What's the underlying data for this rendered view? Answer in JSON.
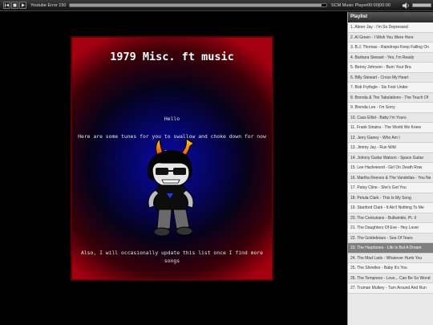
{
  "player": {
    "track_title": "Youtube Error 150",
    "player_name": "SCM Music Player",
    "time": "00:00|00:00",
    "progress": 0.98,
    "volume": 1.0
  },
  "card": {
    "title": "1979 Misc. ft music",
    "hello": "Hello",
    "tunes": "Here are some tunes for you to swallow and choke down for now",
    "enjoy": "Enjoy",
    "footer": "Also, I will occasionally update this list once I find more songs"
  },
  "playlist": {
    "header": "Playlist",
    "active_index": 22,
    "items": [
      "1. Abner Jay - I'm So Depressed",
      "2. Al Green - I Wish You Were Here",
      "3. B.J. Thomas - Raindrops Keep Falling On",
      "4. Barbara Stewart - Yes, I'm Ready",
      "5. Benny Johnson - Burn Your Bra",
      "6. Billy Stewart - Cross My Heart",
      "7. Bob Fryfogle - Six Foot Under",
      "8. Brenda & The Tabulations - The Touch Of",
      "9. Brenda Lee - I'm Sorry",
      "10. Cass Elliot - Baby I'm Yours",
      "11. Frank Sinatra - The World We Knew",
      "12. Jerry Ganey - Who Am I",
      "13. Jimmy Jay - Run Wild",
      "14. Johnny Guitar Watson - Space Guitar",
      "15. Lee Hazlewood - Girl On Death Row",
      "16. Martha Reeves & The Vandellas - You Ne",
      "17. Patsy Cline - She's Got You",
      "18. Petula Clark - This Is My Song",
      "19. Stanford Clark - It Ain't Nothing To Me",
      "20. The Centurians - Bullwinkle, Pt. II",
      "21. The Daughters Of Eve - Hey Lover",
      "22. The Goldebriars - Sea Of Tears",
      "23. The Harptones - Life Is But A Dream",
      "24. The Mad Lads - Whatever Hurts You",
      "25. The Shirelles - Baby It's You",
      "26. The Temprees - Love... Can Be So Wond",
      "27. Truman Mulkey - Turn Around And Run"
    ]
  },
  "colors": {
    "card_glow_center": "#0a0aaa",
    "card_edge": "#a50010",
    "active_row": "#7f7f7f",
    "horn_gradient_start": "#ff4a00",
    "horn_gradient_end": "#ffd000"
  },
  "icons": [
    "prev-icon",
    "stop-icon",
    "play-icon",
    "volume-icon"
  ]
}
